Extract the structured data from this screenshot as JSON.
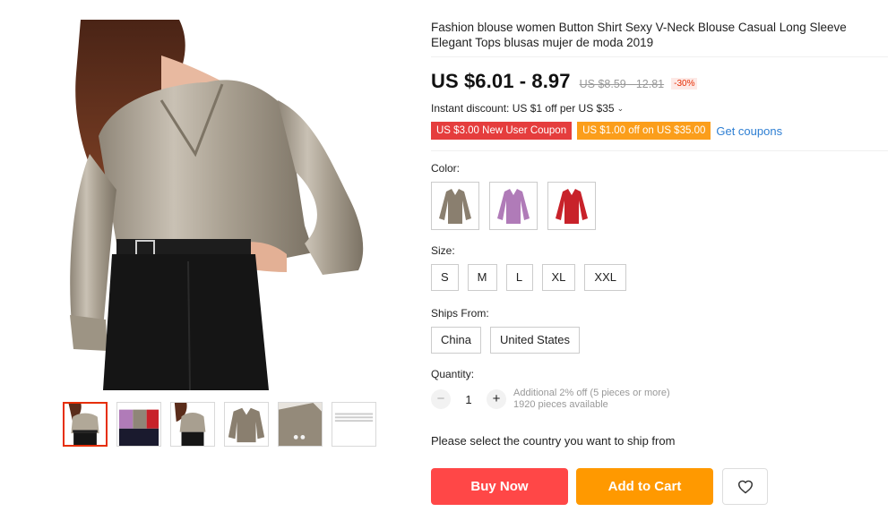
{
  "product": {
    "title": "Fashion blouse women Button Shirt Sexy V-Neck Blouse Casual Long Sleeve Elegant Tops blusas mujer de moda 2019",
    "price": "US $6.01 - 8.97",
    "original_price": "US $8.59 - 12.81",
    "discount": "-30%"
  },
  "promo": {
    "instant_discount": "Instant discount: US $1 off per US $35",
    "coupons": [
      "US $3.00 New User Coupon",
      "US $1.00 off on US $35.00"
    ],
    "get_coupons": "Get coupons"
  },
  "colors": {
    "label": "Color:",
    "options": [
      {
        "icon": "blouse-khaki-swatch",
        "color": "#8a7f6f"
      },
      {
        "icon": "blouse-purple-swatch",
        "color": "#b07bb8"
      },
      {
        "icon": "blouse-red-swatch",
        "color": "#c8222a"
      }
    ]
  },
  "sizes": {
    "label": "Size:",
    "options": [
      "S",
      "M",
      "L",
      "XL",
      "XXL"
    ]
  },
  "ships_from": {
    "label": "Ships From:",
    "options": [
      "China",
      "United States"
    ]
  },
  "quantity": {
    "label": "Quantity:",
    "value": "1",
    "minus": "−",
    "plus": "+",
    "note_line1": "Additional 2% off (5 pieces or more)",
    "note_line2": "1920 pieces available"
  },
  "ship_note": "Please select the country you want to ship from",
  "actions": {
    "buy_now": "Buy Now",
    "add_to_cart": "Add to Cart",
    "wishlist_icon": "heart-icon"
  },
  "gallery": {
    "thumb_count": 6,
    "active_index": 0
  },
  "theme": {
    "accent_red": "#ff4747",
    "accent_orange": "#ff9900",
    "link_blue": "#2e7fd3"
  }
}
